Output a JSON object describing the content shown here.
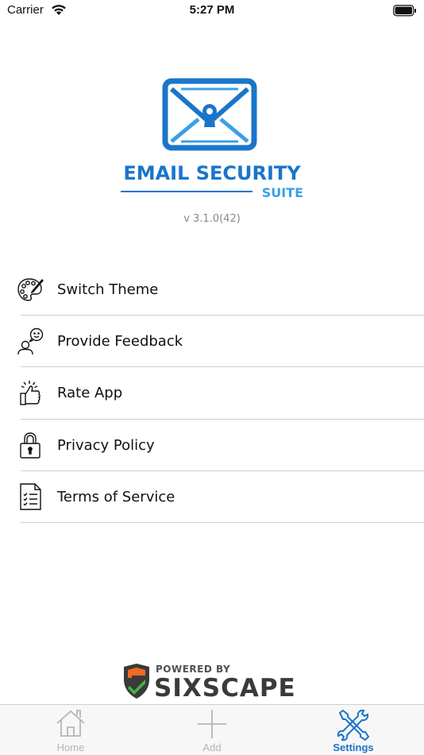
{
  "status_bar": {
    "carrier": "Carrier",
    "time": "5:27 PM"
  },
  "app": {
    "logo_line1": "EMAIL SECURITY",
    "logo_line2": "SUITE",
    "version": "v 3.1.0(42)"
  },
  "menu": {
    "items": [
      {
        "label": "Switch Theme",
        "icon": "palette-icon"
      },
      {
        "label": "Provide Feedback",
        "icon": "feedback-icon"
      },
      {
        "label": "Rate App",
        "icon": "thumbs-up-icon"
      },
      {
        "label": "Privacy Policy",
        "icon": "padlock-icon"
      },
      {
        "label": "Terms of Service",
        "icon": "document-checklist-icon"
      }
    ]
  },
  "footer": {
    "powered_by": "POWERED BY",
    "brand": "SIXSCAPE"
  },
  "tabs": [
    {
      "label": "Home",
      "icon": "home-icon",
      "active": false
    },
    {
      "label": "Add",
      "icon": "plus-icon",
      "active": false
    },
    {
      "label": "Settings",
      "icon": "tools-icon",
      "active": true
    }
  ],
  "colors": {
    "brand_blue": "#1a75c9",
    "light_blue": "#3aa0e6",
    "tab_inactive": "#b5b5b5",
    "shield_orange": "#f26a21",
    "shield_green": "#43b649"
  }
}
